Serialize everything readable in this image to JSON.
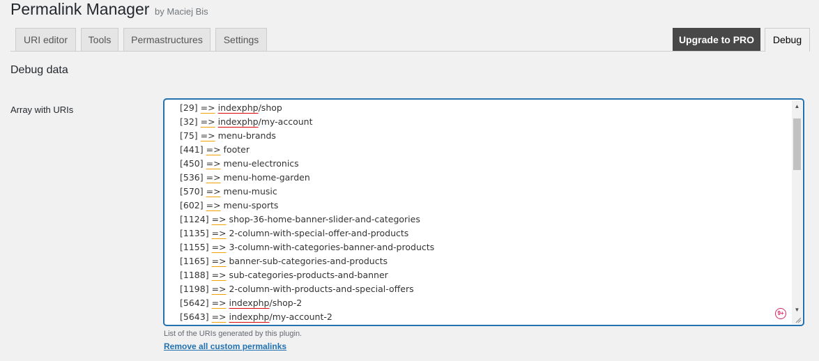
{
  "header": {
    "title": "Permalink Manager",
    "byline": "by Maciej Bis"
  },
  "tabs": [
    {
      "label": "URI editor"
    },
    {
      "label": "Tools"
    },
    {
      "label": "Permastructures"
    },
    {
      "label": "Settings"
    }
  ],
  "upgrade_label": "Upgrade to PRO",
  "debug_tab_label": "Debug",
  "section_title": "Debug data",
  "field": {
    "label": "Array with URIs",
    "lines": [
      {
        "id": "[29]",
        "arrow": "=>",
        "misspelled": "indexphp",
        "rest": "/shop"
      },
      {
        "id": "[32]",
        "arrow": "=>",
        "misspelled": "indexphp",
        "rest": "/my-account"
      },
      {
        "id": "[75]",
        "arrow": "=>",
        "misspelled": "",
        "rest": "menu-brands"
      },
      {
        "id": "[441]",
        "arrow": "=>",
        "misspelled": "",
        "rest": "footer"
      },
      {
        "id": "[450]",
        "arrow": "=>",
        "misspelled": "",
        "rest": "menu-electronics"
      },
      {
        "id": "[536]",
        "arrow": "=>",
        "misspelled": "",
        "rest": "menu-home-garden"
      },
      {
        "id": "[570]",
        "arrow": "=>",
        "misspelled": "",
        "rest": "menu-music"
      },
      {
        "id": "[602]",
        "arrow": "=>",
        "misspelled": "",
        "rest": "menu-sports"
      },
      {
        "id": "[1124]",
        "arrow": "=>",
        "misspelled": "",
        "rest": "shop-36-home-banner-slider-and-categories"
      },
      {
        "id": "[1135]",
        "arrow": "=>",
        "misspelled": "",
        "rest": "2-column-with-special-offer-and-products"
      },
      {
        "id": "[1155]",
        "arrow": "=>",
        "misspelled": "",
        "rest": "3-column-with-categories-banner-and-products"
      },
      {
        "id": "[1165]",
        "arrow": "=>",
        "misspelled": "",
        "rest": "banner-sub-categories-and-products"
      },
      {
        "id": "[1188]",
        "arrow": "=>",
        "misspelled": "",
        "rest": "sub-categories-products-and-banner"
      },
      {
        "id": "[1198]",
        "arrow": "=>",
        "misspelled": "",
        "rest": "2-column-with-products-and-special-offers"
      },
      {
        "id": "[5642]",
        "arrow": "=>",
        "misspelled": "indexphp",
        "rest": "/shop-2"
      },
      {
        "id": "[5643]",
        "arrow": "=>",
        "misspelled": "indexphp",
        "rest": "/my-account-2"
      }
    ],
    "badge": "9+",
    "description": "List of the URIs generated by this plugin.",
    "remove_link": "Remove all custom permalinks"
  },
  "colors": {
    "accent": "#2271b1",
    "pro_button": "#484848",
    "spell_error": "#dd0000",
    "grammar_warn": "#f0a000",
    "badge": "#e0245e"
  }
}
